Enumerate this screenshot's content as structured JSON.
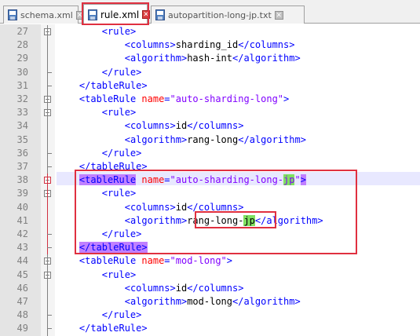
{
  "tabs": [
    {
      "label": "schema.xml",
      "icon": "save-file-icon",
      "active": false
    },
    {
      "label": "rule.xml",
      "icon": "save-file-icon",
      "active": true
    },
    {
      "label": "autopartition-long-jp.txt",
      "icon": "save-file-icon",
      "active": false
    }
  ],
  "close_glyph": "✕",
  "lines": [
    {
      "n": "27",
      "indent": "        ",
      "parts": [
        [
          "b",
          "<"
        ],
        [
          "t",
          "rule"
        ],
        [
          "b",
          ">"
        ]
      ]
    },
    {
      "n": "28",
      "indent": "            ",
      "parts": [
        [
          "b",
          "<"
        ],
        [
          "t",
          "columns"
        ],
        [
          "b",
          ">"
        ],
        [
          "x",
          "sharding_id"
        ],
        [
          "b",
          "</"
        ],
        [
          "t",
          "columns"
        ],
        [
          "b",
          ">"
        ]
      ]
    },
    {
      "n": "29",
      "indent": "            ",
      "parts": [
        [
          "b",
          "<"
        ],
        [
          "t",
          "algorithm"
        ],
        [
          "b",
          ">"
        ],
        [
          "x",
          "hash-int"
        ],
        [
          "b",
          "</"
        ],
        [
          "t",
          "algorithm"
        ],
        [
          "b",
          ">"
        ]
      ]
    },
    {
      "n": "30",
      "indent": "        ",
      "parts": [
        [
          "b",
          "</"
        ],
        [
          "t",
          "rule"
        ],
        [
          "b",
          ">"
        ]
      ]
    },
    {
      "n": "31",
      "indent": "    ",
      "parts": [
        [
          "b",
          "</"
        ],
        [
          "t",
          "tableRule"
        ],
        [
          "b",
          ">"
        ]
      ]
    },
    {
      "n": "32",
      "indent": "    ",
      "parts": [
        [
          "b",
          "<"
        ],
        [
          "t",
          "tableRule "
        ],
        [
          "a",
          "name"
        ],
        [
          "b",
          "="
        ],
        [
          "v",
          "\"auto-sharding-long\""
        ],
        [
          "b",
          ">"
        ]
      ]
    },
    {
      "n": "33",
      "indent": "        ",
      "parts": [
        [
          "b",
          "<"
        ],
        [
          "t",
          "rule"
        ],
        [
          "b",
          ">"
        ]
      ]
    },
    {
      "n": "34",
      "indent": "            ",
      "parts": [
        [
          "b",
          "<"
        ],
        [
          "t",
          "columns"
        ],
        [
          "b",
          ">"
        ],
        [
          "x",
          "id"
        ],
        [
          "b",
          "</"
        ],
        [
          "t",
          "columns"
        ],
        [
          "b",
          ">"
        ]
      ]
    },
    {
      "n": "35",
      "indent": "            ",
      "parts": [
        [
          "b",
          "<"
        ],
        [
          "t",
          "algorithm"
        ],
        [
          "b",
          ">"
        ],
        [
          "x",
          "rang-long"
        ],
        [
          "b",
          "</"
        ],
        [
          "t",
          "algorithm"
        ],
        [
          "b",
          ">"
        ]
      ]
    },
    {
      "n": "36",
      "indent": "        ",
      "parts": [
        [
          "b",
          "</"
        ],
        [
          "t",
          "rule"
        ],
        [
          "b",
          ">"
        ]
      ]
    },
    {
      "n": "37",
      "indent": "    ",
      "parts": [
        [
          "b",
          "</"
        ],
        [
          "t",
          "tableRule"
        ],
        [
          "b",
          ">"
        ]
      ]
    },
    {
      "n": "38",
      "indent": "    ",
      "parts": [
        [
          "B",
          "<tableRule"
        ],
        [
          "t",
          " "
        ],
        [
          "a",
          "name"
        ],
        [
          "b",
          "="
        ],
        [
          "v",
          "\"auto-sharding-long-"
        ],
        [
          "J",
          "jp"
        ],
        [
          "v",
          "\""
        ],
        [
          "B",
          ">"
        ]
      ]
    },
    {
      "n": "39",
      "indent": "        ",
      "parts": [
        [
          "b",
          "<"
        ],
        [
          "t",
          "rule"
        ],
        [
          "b",
          ">"
        ]
      ]
    },
    {
      "n": "40",
      "indent": "            ",
      "parts": [
        [
          "b",
          "<"
        ],
        [
          "t",
          "columns"
        ],
        [
          "b",
          ">"
        ],
        [
          "x",
          "id"
        ],
        [
          "b",
          "</"
        ],
        [
          "t",
          "columns"
        ],
        [
          "b",
          ">"
        ]
      ]
    },
    {
      "n": "41",
      "indent": "            ",
      "parts": [
        [
          "b",
          "<"
        ],
        [
          "t",
          "algorithm"
        ],
        [
          "b",
          ">"
        ],
        [
          "x",
          "rang-long-"
        ],
        [
          "K",
          "jp"
        ],
        [
          "b",
          "</"
        ],
        [
          "t",
          "algorithm"
        ],
        [
          "b",
          ">"
        ]
      ]
    },
    {
      "n": "42",
      "indent": "        ",
      "parts": [
        [
          "b",
          "</"
        ],
        [
          "t",
          "rule"
        ],
        [
          "b",
          ">"
        ]
      ]
    },
    {
      "n": "43",
      "indent": "    ",
      "parts": [
        [
          "B",
          "</tableRule>"
        ]
      ]
    },
    {
      "n": "44",
      "indent": "    ",
      "parts": [
        [
          "b",
          "<"
        ],
        [
          "t",
          "tableRule "
        ],
        [
          "a",
          "name"
        ],
        [
          "b",
          "="
        ],
        [
          "v",
          "\"mod-long\""
        ],
        [
          "b",
          ">"
        ]
      ]
    },
    {
      "n": "45",
      "indent": "        ",
      "parts": [
        [
          "b",
          "<"
        ],
        [
          "t",
          "rule"
        ],
        [
          "b",
          ">"
        ]
      ]
    },
    {
      "n": "46",
      "indent": "            ",
      "parts": [
        [
          "b",
          "<"
        ],
        [
          "t",
          "columns"
        ],
        [
          "b",
          ">"
        ],
        [
          "x",
          "id"
        ],
        [
          "b",
          "</"
        ],
        [
          "t",
          "columns"
        ],
        [
          "b",
          ">"
        ]
      ]
    },
    {
      "n": "47",
      "indent": "            ",
      "parts": [
        [
          "b",
          "<"
        ],
        [
          "t",
          "algorithm"
        ],
        [
          "b",
          ">"
        ],
        [
          "x",
          "mod-long"
        ],
        [
          "b",
          "</"
        ],
        [
          "t",
          "algorithm"
        ],
        [
          "b",
          ">"
        ]
      ]
    },
    {
      "n": "48",
      "indent": "        ",
      "parts": [
        [
          "b",
          "</"
        ],
        [
          "t",
          "rule"
        ],
        [
          "b",
          ">"
        ]
      ]
    },
    {
      "n": "49",
      "indent": "    ",
      "parts": [
        [
          "b",
          "</"
        ],
        [
          "t",
          "tableRule"
        ],
        [
          "b",
          ">"
        ]
      ]
    }
  ],
  "colors": {
    "tag": "#0000ff",
    "attr": "#ff0000",
    "value": "#8000ff",
    "highlight_box": "#e03040",
    "tag_match": "#c080ff",
    "jp_match": "#80e060"
  }
}
